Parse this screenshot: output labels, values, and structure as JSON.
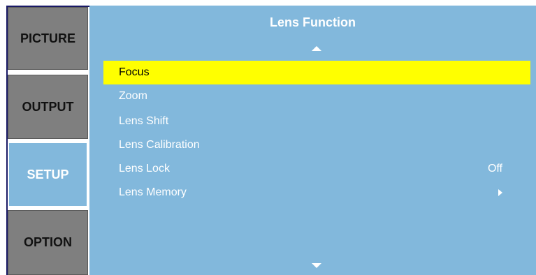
{
  "sidebar": {
    "tabs": [
      {
        "label": "PICTURE",
        "active": false
      },
      {
        "label": "OUTPUT",
        "active": false
      },
      {
        "label": "SETUP",
        "active": true
      },
      {
        "label": "OPTION",
        "active": false
      }
    ]
  },
  "panel": {
    "title": "Lens Function",
    "items": [
      {
        "label": "Focus",
        "value": "",
        "selected": true
      },
      {
        "label": "Zoom",
        "value": ""
      },
      {
        "label": "Lens Shift",
        "value": ""
      },
      {
        "label": "Lens Calibration",
        "value": ""
      },
      {
        "label": "Lens Lock",
        "value": "Off"
      },
      {
        "label": "Lens Memory",
        "value": "",
        "submenu_icon": "triangle-right-icon"
      }
    ],
    "scroll_icons": [
      "triangle-up-icon",
      "triangle-down-icon"
    ]
  },
  "colors": {
    "panel_background": "#82b8dc",
    "selected_row": "#ffff00",
    "inactive_tab": "#7f7f7f",
    "text": "#ffffff"
  }
}
